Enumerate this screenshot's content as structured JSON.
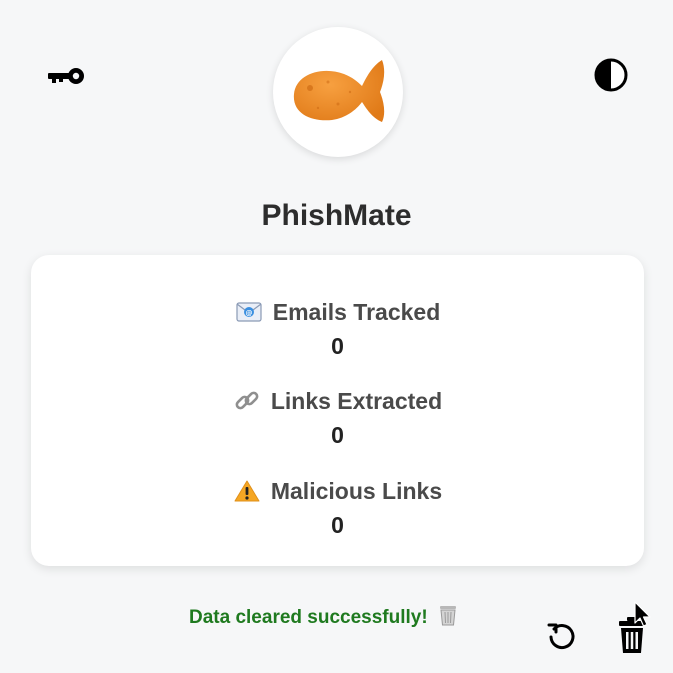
{
  "app": {
    "title": "PhishMate",
    "logo_icon": "goldfish-cracker-icon"
  },
  "header": {
    "left_icon": "key-icon",
    "right_icon": "contrast-toggle-icon"
  },
  "stats": [
    {
      "icon": "envelope-icon",
      "label": "Emails Tracked",
      "value": "0"
    },
    {
      "icon": "link-icon",
      "label": "Links Extracted",
      "value": "0"
    },
    {
      "icon": "warning-icon",
      "label": "Malicious Links",
      "value": "0"
    }
  ],
  "status": {
    "message": "Data cleared successfully!",
    "icon": "wastebasket-icon",
    "color": "#1f7a1f"
  },
  "footer": {
    "refresh_icon": "refresh-icon",
    "delete_icon": "trash-icon"
  },
  "colors": {
    "background": "#f6f7f8",
    "card": "#ffffff",
    "title": "#2d2d2d",
    "success": "#1f7a1f",
    "fish": "#f08a24"
  }
}
